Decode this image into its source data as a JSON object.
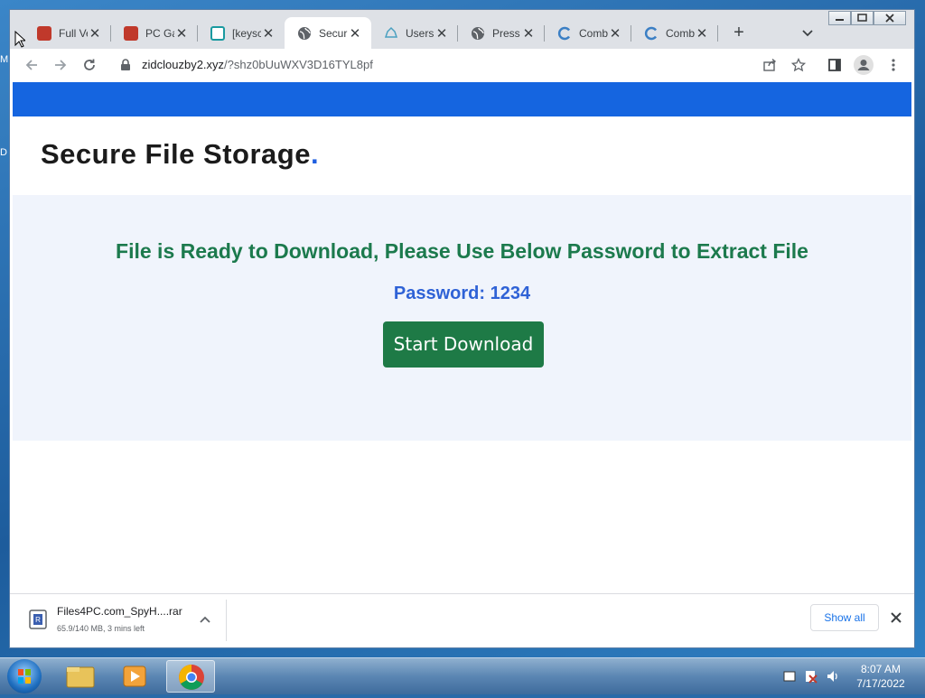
{
  "desktop": {
    "left_letters": [
      "M",
      "D"
    ]
  },
  "browser": {
    "tabs": [
      {
        "title": "Full Ve",
        "favicon": "pc-games-logo-icon",
        "active": false
      },
      {
        "title": "PC Ga",
        "favicon": "pc-games-logo-icon",
        "active": false
      },
      {
        "title": "[keysc",
        "favicon": "keyscore-icon",
        "active": false
      },
      {
        "title": "Secur",
        "favicon": "globe-icon",
        "active": true
      },
      {
        "title": "Users",
        "favicon": "cloud-icon",
        "active": false
      },
      {
        "title": "Press",
        "favicon": "globe-icon",
        "active": false
      },
      {
        "title": "Comb",
        "favicon": "c-logo-icon",
        "active": false
      },
      {
        "title": "Comb",
        "favicon": "c-logo-icon",
        "active": false
      }
    ],
    "url_host": "zidclouzby2.xyz",
    "url_path": "/?shz0bUuWXV3D16TYL8pf"
  },
  "page": {
    "brand": "Secure File Storage",
    "brand_dot": ".",
    "headline": "File is Ready to Download, Please Use Below Password to Extract File",
    "password_line": "Password: 1234",
    "download_button": "Start Download",
    "colors": {
      "top_bar": "#1565e0",
      "headline": "#1c7a4d",
      "password": "#2f62d6",
      "button": "#1e7a46"
    }
  },
  "download_shelf": {
    "file_name": "Files4PC.com_SpyH....rar",
    "progress": "65.9/140 MB, 3 mins left",
    "show_all": "Show all"
  },
  "taskbar": {
    "time": "8:07 AM",
    "date": "7/17/2022"
  }
}
